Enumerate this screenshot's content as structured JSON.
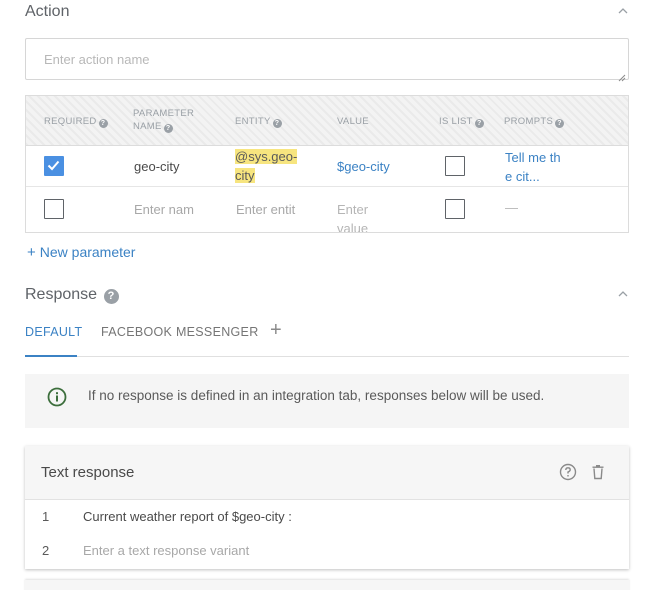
{
  "action": {
    "title": "Action",
    "name_placeholder": "Enter action name"
  },
  "parameters": {
    "headers": {
      "required": "REQUIRED",
      "parameter_name_1": "PARAMETER",
      "parameter_name_2": "NAME",
      "entity": "ENTITY",
      "value": "VALUE",
      "is_list": "IS LIST",
      "prompts": "PROMPTS"
    },
    "rows": [
      {
        "required": true,
        "name": "geo-city",
        "entity_line1": "@sys.geo-",
        "entity_line2": "city",
        "value": "$geo-city",
        "is_list": false,
        "prompts_line1": "Tell me th",
        "prompts_line2": "e cit..."
      }
    ],
    "empty_row": {
      "name_placeholder": "Enter nam",
      "entity_placeholder": "Enter entit",
      "value_placeholder_1": "Enter",
      "value_placeholder_2": "value",
      "prompts_placeholder": "—"
    },
    "new_parameter_label": "New parameter",
    "new_parameter_plus": "+"
  },
  "response": {
    "title": "Response",
    "tabs": [
      {
        "label": "DEFAULT",
        "active": true
      },
      {
        "label": "FACEBOOK MESSENGER",
        "active": false
      }
    ],
    "add_tab_symbol": "+",
    "info_text": "If no response is defined in an integration tab, responses below will be used.",
    "card": {
      "title": "Text response",
      "rows": [
        {
          "num": "1",
          "text": "Current weather report of $geo-city :",
          "placeholder": false
        },
        {
          "num": "2",
          "text": "Enter a text response variant",
          "placeholder": true
        }
      ]
    }
  },
  "colors": {
    "accent": "#3b82c4",
    "checkbox_checked": "#4a90e2",
    "entity_highlight": "#f7e57f",
    "info_icon": "#3c6e3c"
  },
  "icons": {
    "collapse": "chevron-up-icon",
    "help": "help-circle-icon",
    "info": "info-circle-icon",
    "delete": "trash-icon",
    "check": "check-icon"
  }
}
